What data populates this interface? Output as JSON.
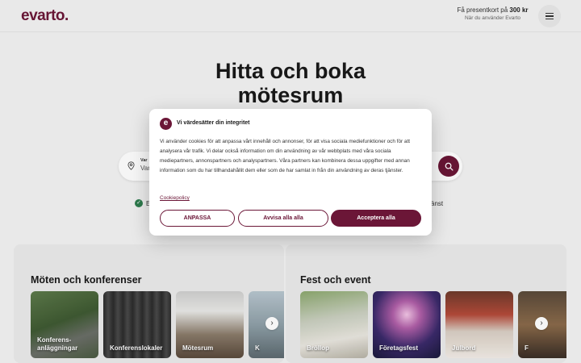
{
  "header": {
    "logo": "evarto",
    "logo_dot": ".",
    "promo_prefix": "Få presentkort på ",
    "promo_amount": "300 kr",
    "promo_sub": "När du använder Evarto"
  },
  "hero": {
    "title_line1": "Hitta och boka",
    "title_line2": "mötesrum",
    "search_label": "Var",
    "search_value": "Var",
    "feature_fragment_left": "E",
    "feature_fragment_right": "tjänst"
  },
  "sections": [
    {
      "title": "Möten och konferenser",
      "cards": [
        {
          "label_line1": "Konferens-",
          "label_line2": "anläggningar"
        },
        {
          "label_line1": "Konferenslokaler",
          "label_line2": ""
        },
        {
          "label_line1": "Mötesrum",
          "label_line2": ""
        },
        {
          "label_line1": "K",
          "label_line2": ""
        }
      ]
    },
    {
      "title": "Fest och event",
      "cards": [
        {
          "label_line1": "Bröllop",
          "label_line2": ""
        },
        {
          "label_line1": "Företagsfest",
          "label_line2": ""
        },
        {
          "label_line1": "Julbord",
          "label_line2": ""
        },
        {
          "label_line1": "F",
          "label_line2": ""
        }
      ]
    }
  ],
  "cookie": {
    "logo_letter": "e",
    "title": "Vi värdesätter din integritet",
    "body": "Vi använder cookies för att anpassa vårt innehåll och annonser, för att visa sociala mediefunktioner och för att analysera vår trafik. Vi delar också information om din användning av vår webbplats med våra sociala mediepartners, annonspartners och analyspartners. Våra partners kan kombinera dessa uppgifter med annan information som du har tillhandahållit dem eller som de har samlat in från din användning av deras tjänster.",
    "policy_link": "Cookiepolicy",
    "btn_customize": "ANPASSA",
    "btn_reject": "Avvisa alla alla",
    "btn_accept": "Acceptera alla"
  },
  "icons": {
    "menu": "hamburger-icon",
    "search": "magnifier-icon",
    "location": "location-pin-icon",
    "check": "check-icon",
    "next": "chevron-right-icon"
  },
  "colors": {
    "brand": "#6b1637",
    "check": "#2e7d4f"
  }
}
